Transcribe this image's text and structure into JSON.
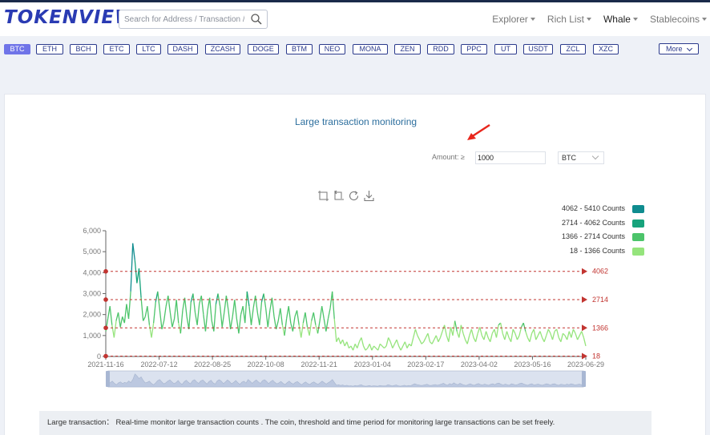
{
  "header": {
    "logo": "TOKENVIEW",
    "search_placeholder": "Search for Address / Transaction / Blo",
    "nav": [
      {
        "label": "Explorer",
        "dropdown": true,
        "active": false
      },
      {
        "label": "Rich List",
        "dropdown": true,
        "active": false
      },
      {
        "label": "Whale",
        "dropdown": true,
        "active": true
      },
      {
        "label": "Stablecoins",
        "dropdown": true,
        "active": false
      }
    ]
  },
  "coins": [
    "BTC",
    "ETH",
    "BCH",
    "ETC",
    "LTC",
    "DASH",
    "ZCASH",
    "DOGE",
    "BTM",
    "NEO",
    "MONA",
    "ZEN",
    "RDD",
    "PPC",
    "UT",
    "USDT",
    "ZCL",
    "XZC"
  ],
  "selected_coin": "BTC",
  "more_label": "More",
  "panel": {
    "title": "Large transaction monitoring",
    "amount_label": "Amount: ≥",
    "amount_value": "1000",
    "coin_select": "BTC",
    "toolbox": [
      "zoom-icon",
      "zoom-reset-icon",
      "restore-icon",
      "save-image-icon"
    ],
    "description": "Large transaction：  Real-time monitor large transaction counts . The coin, threshold and time period for monitoring large transactions can be set freely."
  },
  "colors": {
    "accent": "#6f74e8",
    "brand": "#2a3bb3",
    "threshold": "#c23531",
    "band1": "#95e47c",
    "band2": "#4cc46a",
    "band3": "#17a37c",
    "band4": "#0f8c8f"
  },
  "chart_data": {
    "type": "line",
    "title": "Large transaction monitoring",
    "x_labels": [
      "2021-11-16",
      "2022-07-12",
      "2022-08-25",
      "2022-10-08",
      "2022-11-21",
      "2023-01-04",
      "2023-02-17",
      "2023-04-02",
      "2023-05-16",
      "2023-06-29"
    ],
    "y_ticks": [
      "0",
      "1,000",
      "2,000",
      "3,000",
      "4,000",
      "5,000",
      "6,000"
    ],
    "ylim": [
      0,
      6000
    ],
    "threshold_lines": [
      {
        "label": "4062",
        "value": 4062
      },
      {
        "label": "2714",
        "value": 2714
      },
      {
        "label": "1366",
        "value": 1366
      },
      {
        "label": "18",
        "value": 18
      }
    ],
    "legend": [
      {
        "label": "4062 - 5410 Counts",
        "color": "#0f8c8f"
      },
      {
        "label": "2714 - 4062 Counts",
        "color": "#17a37c"
      },
      {
        "label": "1366 - 2714 Counts",
        "color": "#4cc46a"
      },
      {
        "label": "18 - 1366 Counts",
        "color": "#95e47c"
      }
    ],
    "series": [
      {
        "values": [
          1200,
          1800,
          2400,
          1500,
          900,
          1700,
          2100,
          1400,
          1900,
          1600,
          2500,
          1800,
          3100,
          5400,
          4600,
          3500,
          4200,
          2800,
          1700,
          1900,
          2400,
          1500,
          900,
          1600,
          2600,
          3100,
          2200,
          1300,
          1700,
          2400,
          2900,
          2100,
          1400,
          1800,
          2700,
          1600,
          1100,
          2200,
          2800,
          1900,
          1300,
          2600,
          3000,
          2100,
          1500,
          2500,
          2900,
          2000,
          1200,
          2200,
          2800,
          1700,
          1200,
          2500,
          3000,
          2400,
          1400,
          2100,
          2900,
          2200,
          1300,
          1900,
          2700,
          1800,
          1100,
          2000,
          2400,
          1600,
          3100,
          2400,
          1500,
          2300,
          2900,
          2100,
          1500,
          2600,
          3000,
          2300,
          1400,
          2200,
          2800,
          1900,
          1300,
          1700,
          2300,
          1500,
          1000,
          1800,
          2400,
          1600,
          1200,
          1900,
          2200,
          1500,
          900,
          1600,
          2100,
          1400,
          1000,
          1700,
          2100,
          1500,
          1100,
          1700,
          2400,
          1800,
          1200,
          1800,
          2300,
          3100,
          1800,
          700,
          900,
          600,
          800,
          500,
          700,
          400,
          500,
          300,
          600,
          400,
          700,
          900,
          500,
          300,
          400,
          600,
          300,
          500,
          400,
          300,
          600,
          500,
          400,
          500,
          900,
          700,
          400,
          600,
          800,
          500,
          300,
          500,
          700,
          400,
          600,
          500,
          900,
          1300,
          1000,
          800,
          600,
          700,
          900,
          1100,
          700,
          600,
          800,
          1000,
          700,
          900,
          1200,
          1500,
          1000,
          700,
          1400,
          1000,
          1700,
          1200,
          900,
          1500,
          1100,
          800,
          600,
          1000,
          1300,
          900,
          700,
          1100,
          1400,
          1000,
          800,
          1200,
          900,
          700,
          1100,
          1300,
          900,
          1500,
          1600,
          1100,
          800,
          1200,
          900,
          700,
          1300,
          1100,
          800,
          1000,
          1400,
          1600,
          1200,
          900,
          700,
          1100,
          1300,
          800,
          1000,
          1200,
          900,
          700,
          1000,
          1300,
          1100,
          800,
          1200,
          1300,
          900,
          700,
          1100,
          1000,
          800,
          1200,
          900,
          1300,
          1100,
          800,
          1000,
          1200,
          900,
          500
        ]
      }
    ]
  }
}
